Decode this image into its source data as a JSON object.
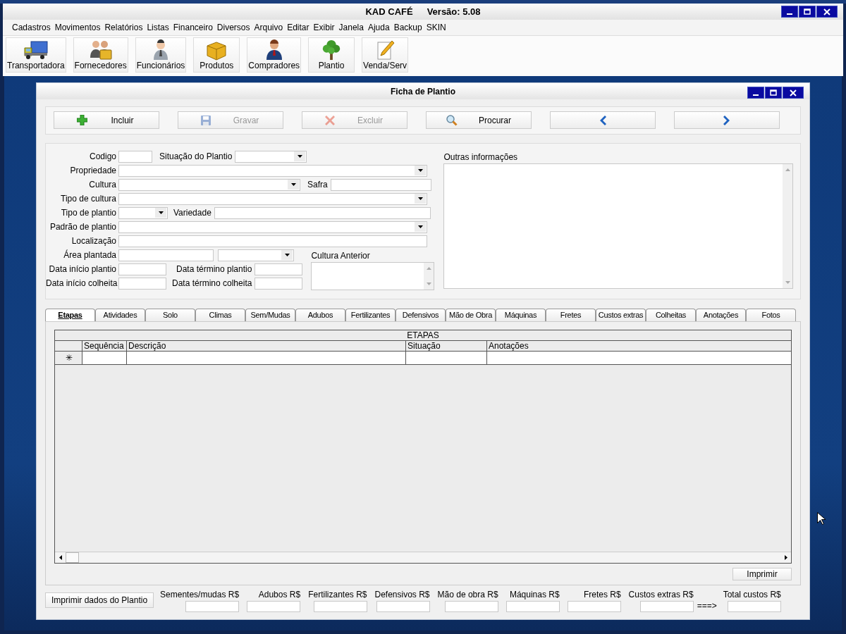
{
  "window": {
    "app_name": "KAD CAFÉ",
    "version": "Versão: 5.08"
  },
  "menu": [
    "Cadastros",
    "Movimentos",
    "Relatórios",
    "Listas",
    "Financeiro",
    "Diversos",
    "Arquivo",
    "Editar",
    "Exibir",
    "Janela",
    "Ajuda",
    "Backup",
    "SKIN"
  ],
  "toolbar": [
    {
      "label": "Transportadora",
      "kind": "truck"
    },
    {
      "label": "Fornecedores",
      "kind": "people"
    },
    {
      "label": "Funcionários",
      "kind": "person"
    },
    {
      "label": "Produtos",
      "kind": "box"
    },
    {
      "label": "Compradores",
      "kind": "suit"
    },
    {
      "label": "Plantio",
      "kind": "tree"
    },
    {
      "label": "Venda/Serv",
      "kind": "pencil"
    }
  ],
  "child_window": {
    "title": "Ficha de Plantio",
    "actions": [
      {
        "label": "Incluir",
        "kind": "add",
        "disabled": false
      },
      {
        "label": "Gravar",
        "kind": "save",
        "disabled": true
      },
      {
        "label": "Excluir",
        "kind": "delete",
        "disabled": true
      },
      {
        "label": "Procurar",
        "kind": "search",
        "disabled": false
      },
      {
        "kind": "prev",
        "disabled": false
      },
      {
        "kind": "next",
        "disabled": false
      }
    ],
    "fields": [
      {
        "label": "Codigo",
        "kind": "text"
      },
      {
        "label": "Situação do Plantio",
        "kind": "combo"
      },
      {
        "label": "Propriedade",
        "kind": "combo"
      },
      {
        "label": "Cultura",
        "kind": "combo"
      },
      {
        "label": "Safra",
        "kind": "text"
      },
      {
        "label": "Tipo de cultura",
        "kind": "combo"
      },
      {
        "label": "Tipo de plantio",
        "kind": "combo"
      },
      {
        "label": "Variedade",
        "kind": "text"
      },
      {
        "label": "Padrão de plantio",
        "kind": "combo"
      },
      {
        "label": "Localização",
        "kind": "text"
      },
      {
        "label": "Área plantada",
        "kind": "text"
      },
      {
        "kind": "combo"
      },
      {
        "label": "Data início plantio",
        "kind": "text"
      },
      {
        "label": "Data término plantio",
        "kind": "text"
      },
      {
        "label": "Data início colheita",
        "kind": "text"
      },
      {
        "label": "Data término colheita",
        "kind": "text"
      }
    ],
    "previous_crop": {
      "label": "Cultura Anterior"
    },
    "other_info": {
      "label": "Outras informações"
    },
    "tabs": [
      {
        "label": "Etapas",
        "selected": true
      },
      {
        "label": "Atividades",
        "selected": false
      },
      {
        "label": "Solo",
        "selected": false
      },
      {
        "label": "Climas",
        "selected": false
      },
      {
        "label": "Sem/Mudas",
        "selected": false
      },
      {
        "label": "Adubos",
        "selected": false
      },
      {
        "label": "Fertilizantes",
        "selected": false
      },
      {
        "label": "Defensivos",
        "selected": false
      },
      {
        "label": "Mão de Obra",
        "selected": false
      },
      {
        "label": "Máquinas",
        "selected": false
      },
      {
        "label": "Fretes",
        "selected": false
      },
      {
        "label": "Custos extras",
        "selected": false
      },
      {
        "label": "Colheitas",
        "selected": false
      },
      {
        "label": "Anotações",
        "selected": false
      },
      {
        "label": "Fotos",
        "selected": false
      }
    ],
    "grid": {
      "title": "ETAPAS",
      "columns": [
        "Sequência",
        "Descrição",
        "Situação",
        "Anotações"
      ],
      "new_row_marker": "✳"
    },
    "print_button": "Imprimir",
    "print_plan_button": "Imprimir dados do Plantio",
    "totals": [
      "Sementes/mudas R$",
      "Adubos R$",
      "Fertilizantes R$",
      "Defensivos R$",
      "Mão de obra R$",
      "Máquinas R$",
      "Fretes R$",
      "Custos extras R$"
    ],
    "arrow": "===>",
    "grand_total": "Total custos R$"
  }
}
